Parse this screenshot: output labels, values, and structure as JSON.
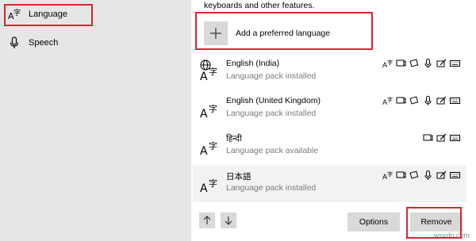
{
  "sidebar": {
    "items": [
      {
        "label": "Language",
        "icon": "language-icon"
      },
      {
        "label": "Speech",
        "icon": "microphone-icon"
      }
    ]
  },
  "main": {
    "intro_text": "keyboards and other features.",
    "add_language_label": "Add a preferred language"
  },
  "languages": [
    {
      "name": "English (India)",
      "status": "Language pack installed",
      "features": [
        "display-language-icon",
        "text-to-speech-icon",
        "handwriting-icon",
        "speech-recognition-icon",
        "handwriting-pen-icon",
        "keyboard-icon"
      ]
    },
    {
      "name": "English (United Kingdom)",
      "status": "Language pack installed",
      "features": [
        "display-language-icon",
        "text-to-speech-icon",
        "handwriting-icon",
        "speech-recognition-icon",
        "handwriting-pen-icon",
        "keyboard-icon"
      ]
    },
    {
      "name": "हिन्दी",
      "status": "Language pack available",
      "features": [
        "text-to-speech-icon",
        "handwriting-pen-icon",
        "keyboard-icon"
      ]
    },
    {
      "name": "日本語",
      "status": "Language pack installed",
      "features": [
        "display-language-icon",
        "text-to-speech-icon",
        "handwriting-icon",
        "speech-recognition-icon",
        "handwriting-pen-icon",
        "keyboard-icon"
      ]
    }
  ],
  "buttons": {
    "options_label": "Options",
    "remove_label": "Remove"
  },
  "watermark": "wsxdn.com",
  "colors": {
    "sidebar_bg": "#e6e6e6",
    "highlight_red": "#d8262e",
    "button_gray": "#d9d9d9",
    "status_gray": "#7a7a7a"
  }
}
